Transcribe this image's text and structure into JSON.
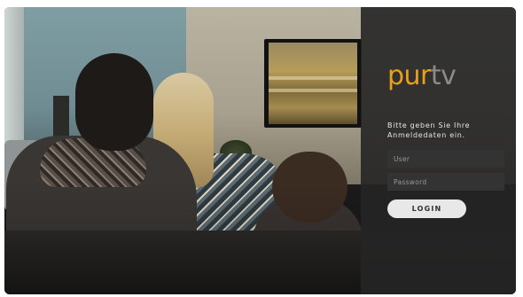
{
  "brand": {
    "logo_part1": "pur",
    "logo_part2": "tv",
    "colors": {
      "accent": "#e8a11c",
      "secondary": "#8b8b8b",
      "panel": "#252525"
    }
  },
  "login": {
    "prompt": "Bitte geben Sie Ihre Anmeldedaten ein.",
    "user_placeholder": "User",
    "user_value": "",
    "password_placeholder": "Password",
    "password_value": "",
    "button_label": "LOGIN"
  }
}
